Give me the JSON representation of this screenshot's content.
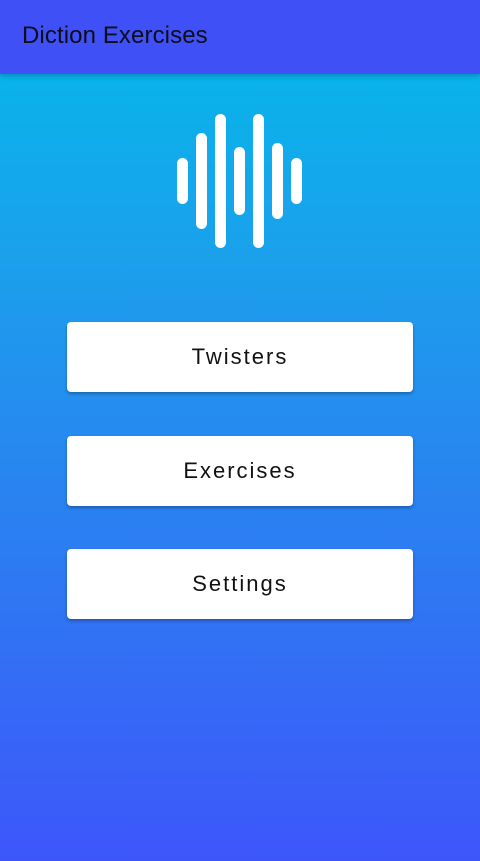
{
  "app_bar": {
    "title": "Diction Exercises"
  },
  "logo": {
    "icon": "sound-wave-icon",
    "color": "#ffffff"
  },
  "menu": {
    "buttons": [
      {
        "label": "Twisters"
      },
      {
        "label": "Exercises"
      },
      {
        "label": "Settings"
      }
    ]
  },
  "colors": {
    "app_bar": "#3f51f6",
    "gradient_top": "#02bae9",
    "gradient_bottom": "#3d56fa",
    "button_background": "#ffffff",
    "button_text": "#111111"
  }
}
